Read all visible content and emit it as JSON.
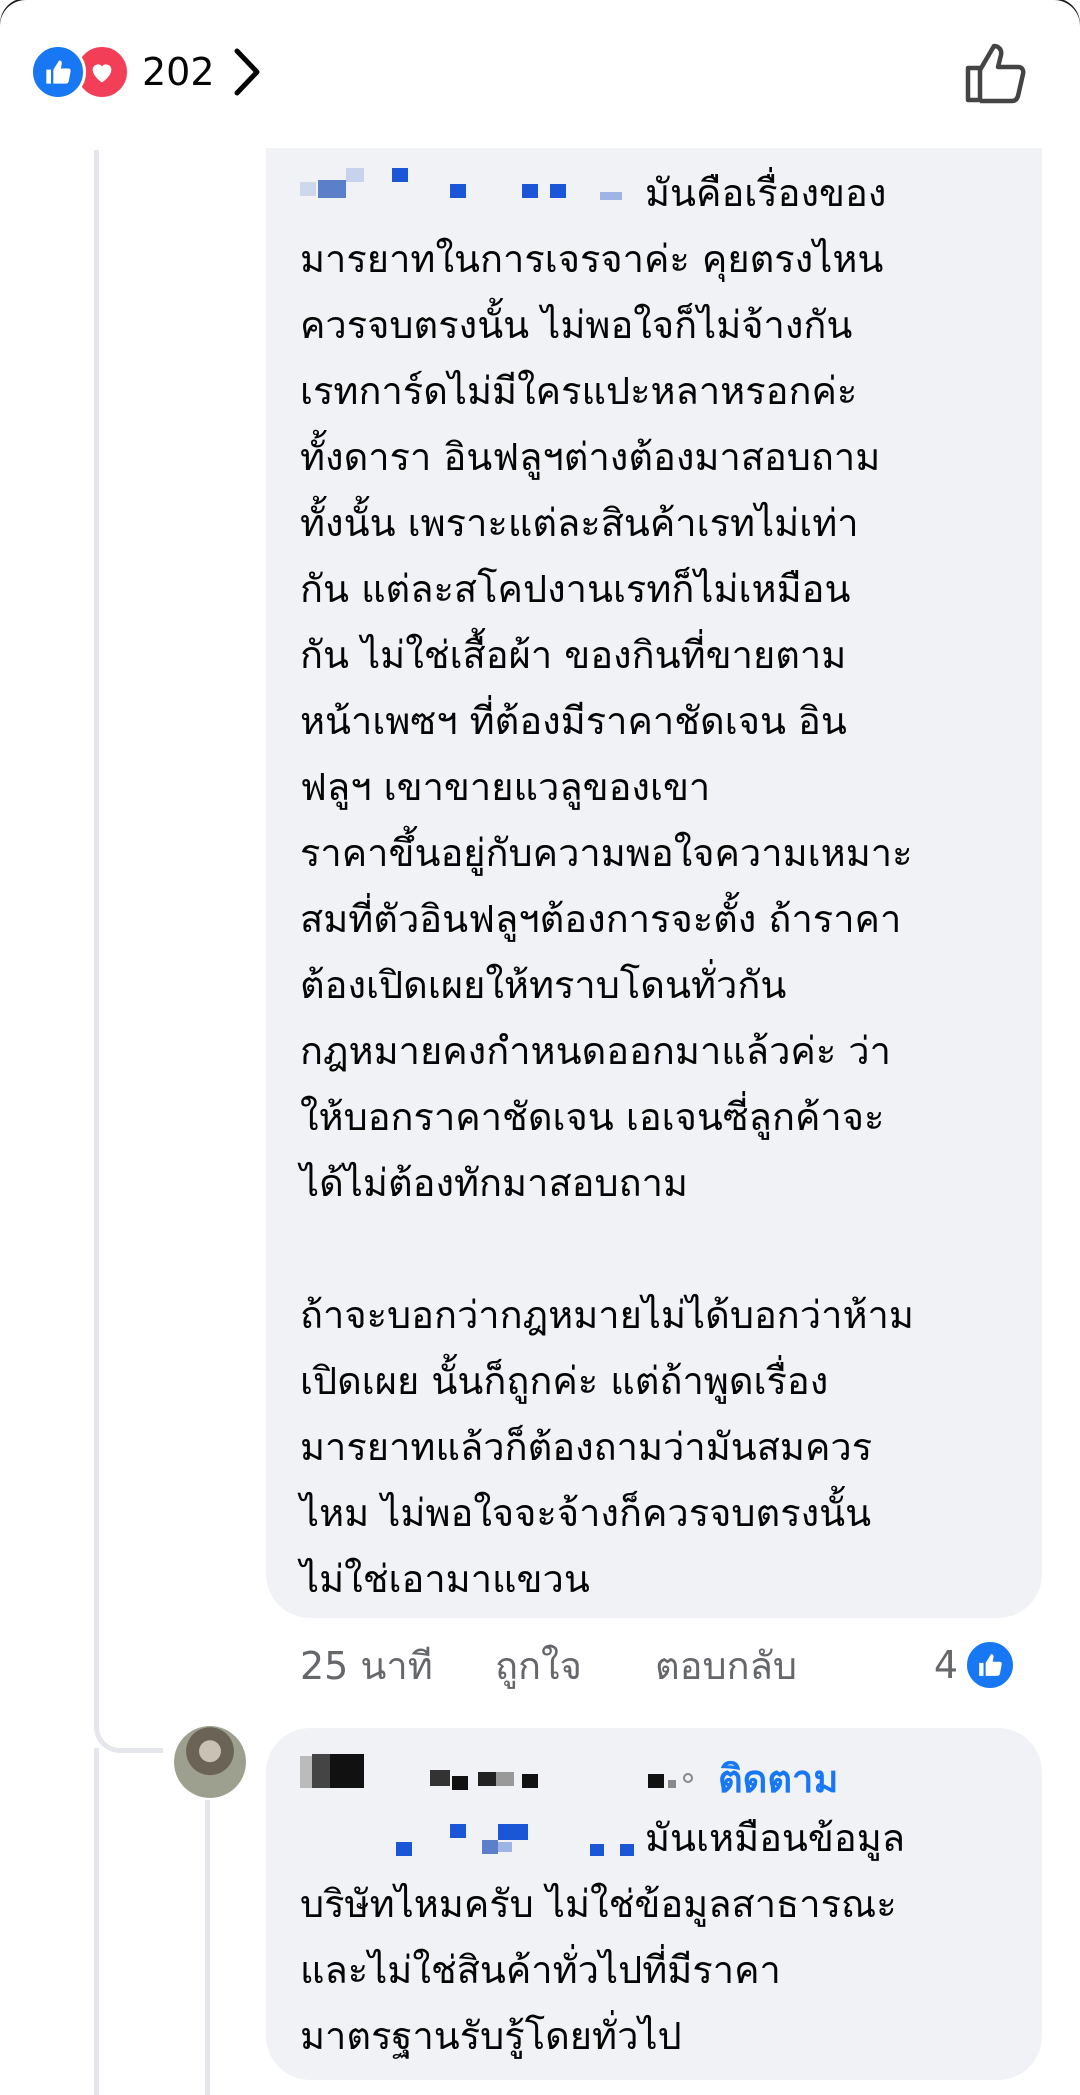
{
  "header": {
    "reaction_count": "202"
  },
  "comment1": {
    "text": "มันคือเรื่องของ\nมารยาทในการเจรจาค่ะ คุยตรงไหน\nควรจบตรงนั้น ไม่พอใจก็ไม่จ้างกัน\nเรทการ์ดไม่มีใครแปะหลาหรอกค่ะ\nทั้งดารา อินฟลูฯต่างต้องมาสอบถาม\nทั้งนั้น เพราะแต่ละสินค้าเรทไม่เท่า\nกัน แต่ละสโคปงานเรทก็ไม่เหมือน\nกัน ไม่ใช่เสื้อผ้า ของกินที่ขายตาม\nหน้าเพซฯ ที่ต้องมีราคาชัดเจน อิน\nฟลูฯ เขาขายแวลูของเขา\nราคาขึ้นอยู่กับความพอใจความเหมาะ\nสมที่ตัวอินฟลูฯต้องการจะตั้ง ถ้าราคา\nต้องเปิดเผยให้ทราบโดนทั่วกัน\nกฎหมายคงกำหนดออกมาแล้วค่ะ ว่า\nให้บอกราคาชัดเจน เอเจนซี่ลูกค้าจะ\nได้ไม่ต้องทักมาสอบถาม\n\nถ้าจะบอกว่ากฎหมายไม่ได้บอกว่าห้าม\nเปิดเผย นั้นก็ถูกค่ะ แต่ถ้าพูดเรื่อง\nมารยาทแล้วก็ต้องถามว่ามันสมควร\nไหม ไม่พอใจจะจ้างก็ควรจบตรงนั้น\nไม่ใช่เอามาแขวน",
    "time": "25 นาที",
    "like_label": "ถูกใจ",
    "reply_label": "ตอบกลับ",
    "reaction_count": "4"
  },
  "comment2": {
    "follow_label": "ติดตาม",
    "text": "มันเหมือนข้อมูล\nบริษัทไหมครับ ไม่ใช่ข้อมูลสาธารณะ\nและไม่ใช่สินค้าทั่วไปที่มีราคา\nมาตรฐานรับรู้โดยทั่วไป"
  },
  "colors": {
    "accent": "#1877f2",
    "love": "#f33e58",
    "bubble": "#f0f2f5",
    "meta": "#65676b"
  },
  "icons": [
    "like-reaction-icon",
    "love-reaction-icon",
    "chevron-right-icon",
    "thumbs-up-outline-icon",
    "avatar"
  ]
}
